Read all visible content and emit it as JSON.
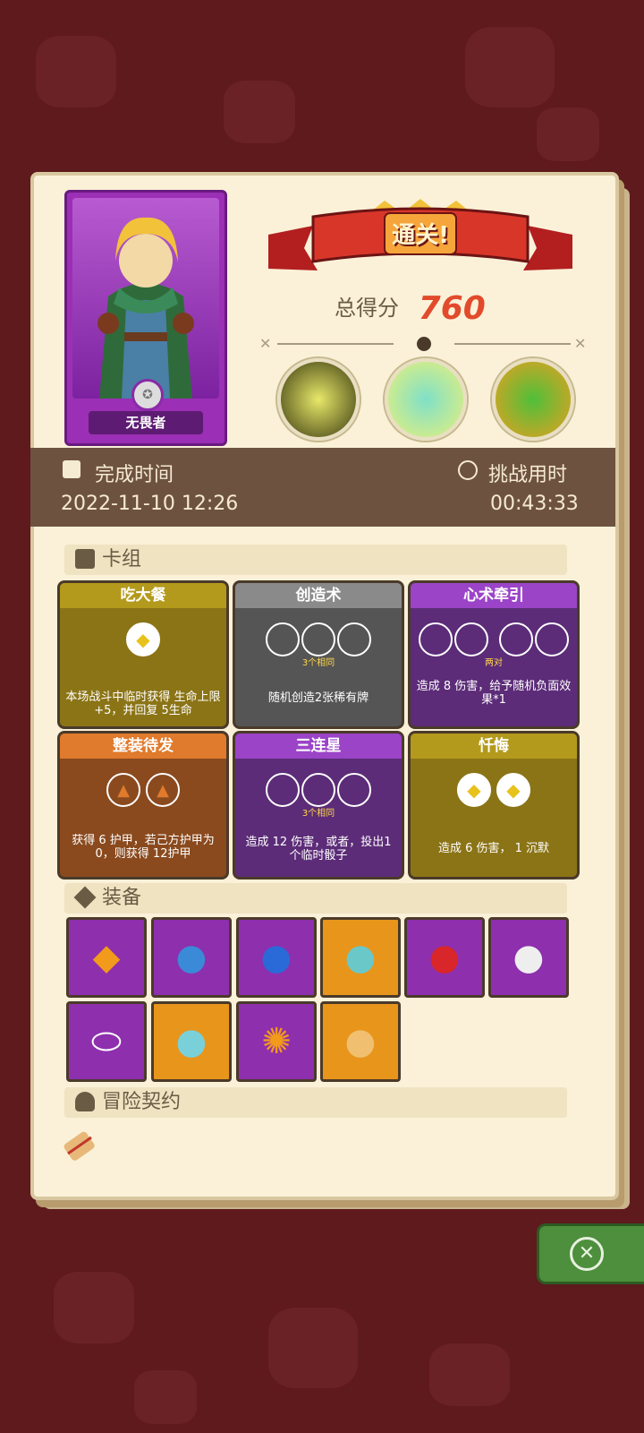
{
  "hero": {
    "name": "无畏者"
  },
  "result": {
    "banner": "通关!",
    "score_label": "总得分",
    "score_value": "760"
  },
  "info": {
    "complete_label": "完成时间",
    "complete_value": "2022-11-10 12:26",
    "duration_label": "挑战用时",
    "duration_value": "00:43:33"
  },
  "sections": {
    "deck": "卡组",
    "equipment": "装备",
    "contract": "冒险契约"
  },
  "cards": [
    {
      "title": "吃大餐",
      "sub": "",
      "desc": "本场战斗中临时获得 生命上限+5，并回复 5生命"
    },
    {
      "title": "创造术",
      "sub": "3个相同",
      "desc": "随机创造2张稀有牌"
    },
    {
      "title": "心术牵引",
      "sub": "两对",
      "desc": "造成 8 伤害，给予随机负面效果*1"
    },
    {
      "title": "整装待发",
      "sub": "",
      "desc": "获得 6 护甲，若己方护甲为0，则获得 12护甲"
    },
    {
      "title": "三连星",
      "sub": "3个相同",
      "desc": "造成 12 伤害，或者，投出1个临时骰子"
    },
    {
      "title": "忏悔",
      "sub": "",
      "desc": "造成 6 伤害， 1 沉默"
    }
  ],
  "colors": {
    "score": "#e24a2c",
    "panel": "#faf1d8",
    "info_bar": "#6e5240",
    "background": "#5e1a1c"
  }
}
